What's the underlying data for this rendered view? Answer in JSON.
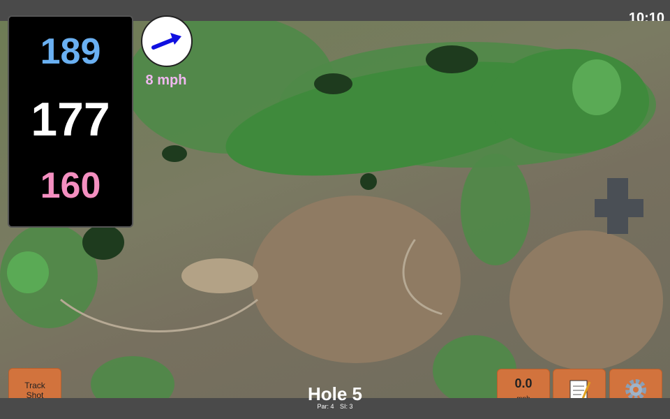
{
  "status": {
    "time": "10:10"
  },
  "distances": {
    "back": "189",
    "middle": "177",
    "front": "160"
  },
  "wind": {
    "speed_label": "8 mph",
    "icon": "arrow-right-up-icon"
  },
  "controls": {
    "track_shot_line1": "Track",
    "track_shot_line2": "Shot",
    "wind_speed_value": "0.0",
    "wind_speed_unit": "mph",
    "notes_icon": "notepad-icon",
    "settings_icon": "gear-icon"
  },
  "hole": {
    "title": "Hole 5",
    "par_label": "Par: 4",
    "si_label": "SI: 3"
  },
  "colors": {
    "back": "#6ab0f2",
    "middle": "#ffffff",
    "front": "#f48fc0",
    "button": "#d2733d",
    "wind_text": "#f0b8f0"
  }
}
